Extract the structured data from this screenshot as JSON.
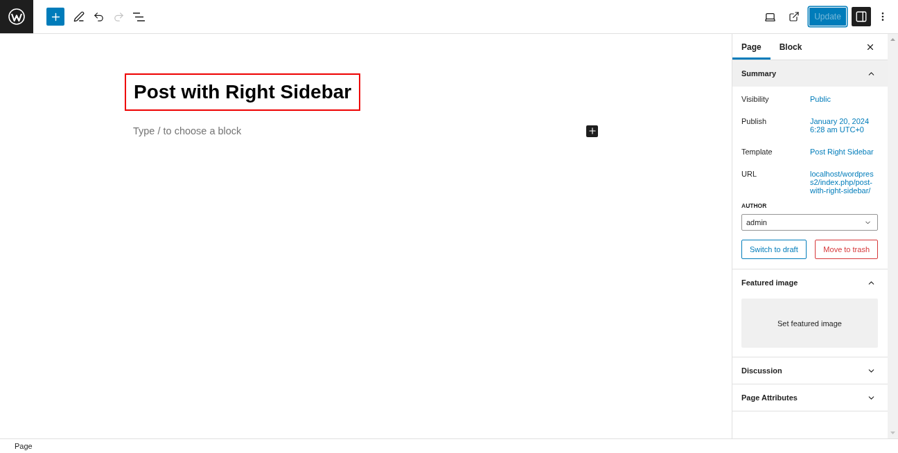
{
  "top_bar": {
    "undo": {
      "disabled": false
    },
    "redo": {
      "disabled": true
    },
    "update_button": {
      "label": "Update",
      "disabled": true
    },
    "settings_toggle": {
      "pressed": true
    }
  },
  "editor": {
    "title": {
      "text": "Post with Right Sidebar",
      "highlighted": true
    },
    "paragraph": {
      "placeholder": "Type / to choose a block"
    }
  },
  "sidebar": {
    "tabs": [
      {
        "label": "Page",
        "selected": true
      },
      {
        "label": "Block",
        "selected": false
      }
    ],
    "panels": [
      {
        "kind": "summary",
        "title": "Summary",
        "expanded": true,
        "highlighted": true,
        "rows": [
          {
            "label": "Visibility",
            "value": "Public"
          },
          {
            "label": "Publish",
            "value": "January 20, 2024 6:28 am UTC+0"
          },
          {
            "label": "Template",
            "value": "Post Right Sidebar"
          },
          {
            "label": "URL",
            "value": "localhost/wordpress2/index.php/post-with-right-sidebar/"
          }
        ],
        "author": {
          "label": "AUTHOR",
          "value": "admin"
        },
        "buttons": [
          {
            "kind": "secondary",
            "label": "Switch to draft"
          },
          {
            "kind": "destructive",
            "label": "Move to trash"
          }
        ]
      },
      {
        "kind": "featured_image",
        "title": "Featured image",
        "expanded": true,
        "highlighted": false,
        "button": "Set featured image"
      },
      {
        "kind": "plain",
        "title": "Discussion",
        "expanded": false,
        "highlighted": false
      },
      {
        "kind": "plain",
        "title": "Page Attributes",
        "expanded": false,
        "highlighted": false
      }
    ]
  },
  "status_bar": {
    "breadcrumb": "Page"
  }
}
